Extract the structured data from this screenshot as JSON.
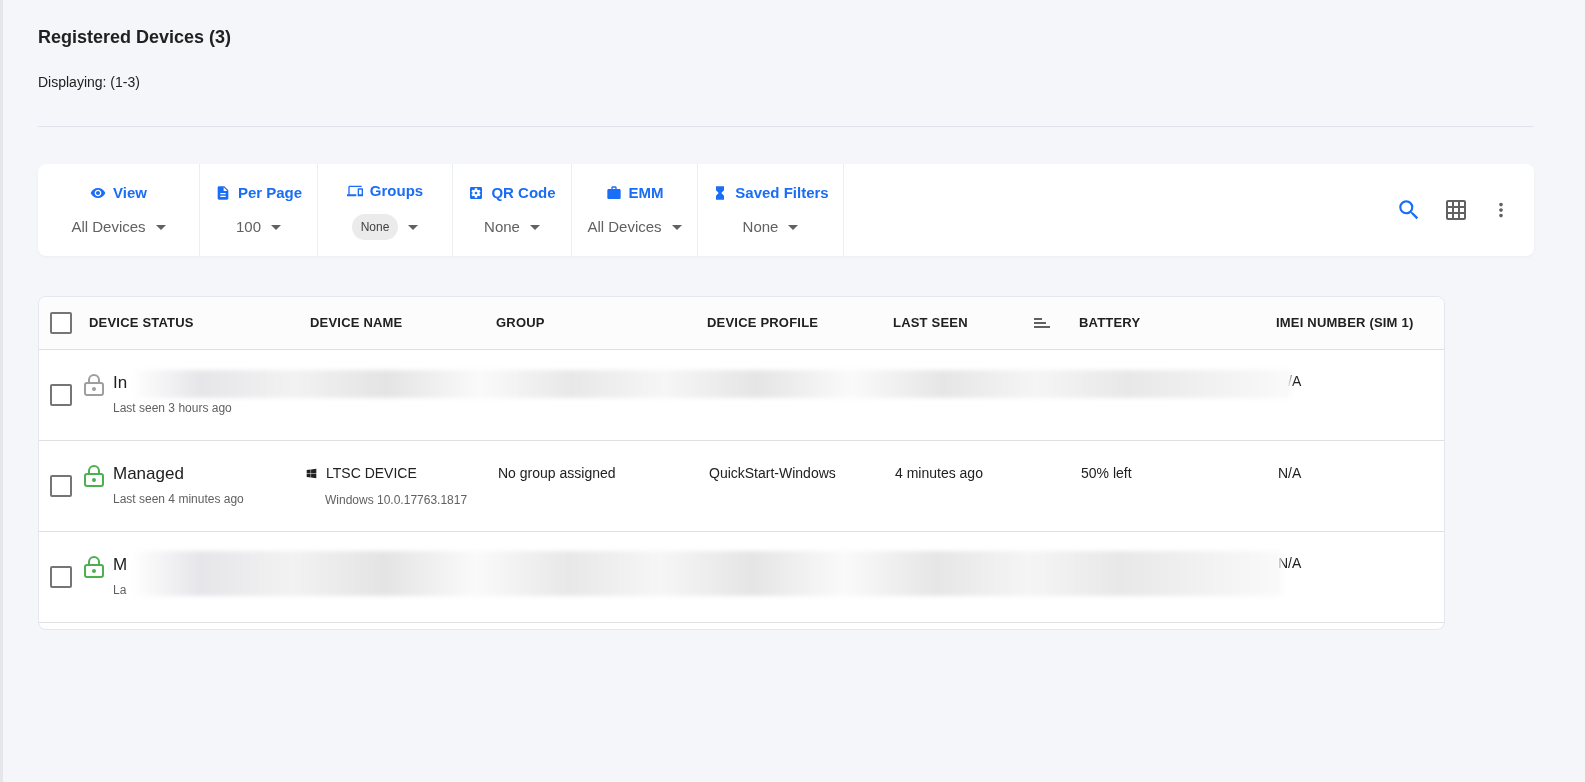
{
  "header": {
    "title": "Registered Devices (3)",
    "displaying": "Displaying: (1-3)"
  },
  "filters": [
    {
      "kind": "view",
      "label": "View",
      "value": "All Devices",
      "chip": false
    },
    {
      "kind": "per_page",
      "label": "Per Page",
      "value": "100",
      "chip": false
    },
    {
      "kind": "groups",
      "label": "Groups",
      "value": "None",
      "chip": true
    },
    {
      "kind": "qr",
      "label": "QR Code",
      "value": "None",
      "chip": false
    },
    {
      "kind": "emm",
      "label": "EMM",
      "value": "All Devices",
      "chip": false
    },
    {
      "kind": "saved",
      "label": "Saved Filters",
      "value": "None",
      "chip": false
    }
  ],
  "table": {
    "select_all": {
      "checked": false
    },
    "columns": [
      "DEVICE STATUS",
      "DEVICE NAME",
      "GROUP",
      "DEVICE PROFILE",
      "LAST SEEN",
      "BATTERY",
      "IMEI NUMBER (SIM 1)"
    ],
    "rows": [
      {
        "redacted": true,
        "checked": false,
        "color": "#9e9e9e",
        "status": "In",
        "status_sub": "Last seen 3 hours ago",
        "imei": "/A"
      },
      {
        "redacted": false,
        "checked": false,
        "color": "#4caf50",
        "status": "Managed",
        "status_sub": "Last seen 4 minutes ago",
        "name": "LTSC DEVICE",
        "os": "Windows 10.0.17763.1817",
        "group": "No group assigned",
        "profile": "QuickStart-Windows",
        "last_seen": "4 minutes ago",
        "battery": "50% left",
        "imei": "N/A"
      },
      {
        "redacted": true,
        "checked": false,
        "color": "#4caf50",
        "status": "M",
        "status_sub": "La",
        "imei": "N/A"
      }
    ]
  }
}
